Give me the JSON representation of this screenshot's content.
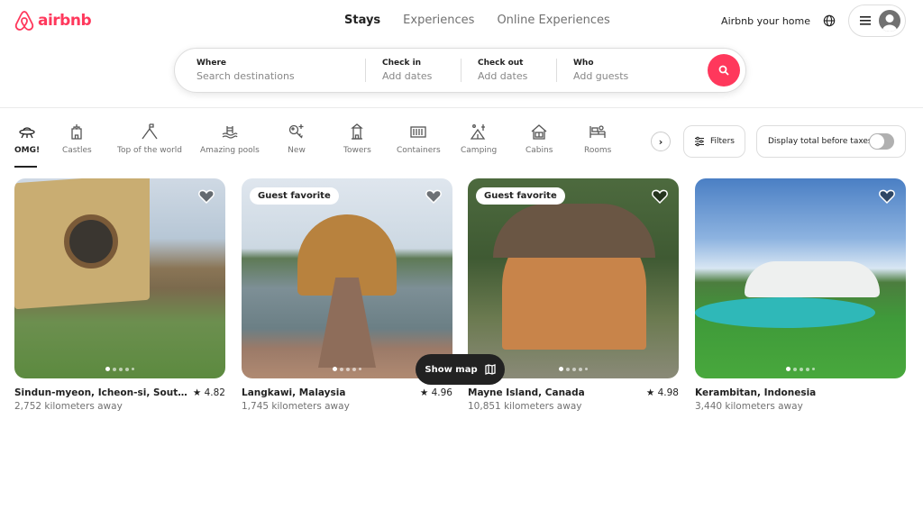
{
  "brand": {
    "name": "airbnb",
    "color": "#ff385c"
  },
  "nav": {
    "tabs": [
      {
        "label": "Stays",
        "active": true
      },
      {
        "label": "Experiences",
        "active": false
      },
      {
        "label": "Online Experiences",
        "active": false
      }
    ]
  },
  "header_right": {
    "host_label": "Airbnb your home",
    "globe_icon": "globe-icon",
    "menu_icon": "hamburger-icon",
    "avatar_icon": "user-avatar-icon"
  },
  "search": {
    "where": {
      "label": "Where",
      "placeholder": "Search destinations"
    },
    "check_in": {
      "label": "Check in",
      "placeholder": "Add dates"
    },
    "check_out": {
      "label": "Check out",
      "placeholder": "Add dates"
    },
    "who": {
      "label": "Who",
      "placeholder": "Add guests"
    },
    "button_icon": "search-icon"
  },
  "categories": [
    {
      "label": "OMG!",
      "icon": "ufo-icon",
      "active": true
    },
    {
      "label": "Castles",
      "icon": "castle-icon"
    },
    {
      "label": "Top of the world",
      "icon": "mountain-flag-icon"
    },
    {
      "label": "Amazing pools",
      "icon": "pool-icon"
    },
    {
      "label": "New",
      "icon": "key-sparkle-icon"
    },
    {
      "label": "Towers",
      "icon": "tower-icon"
    },
    {
      "label": "Containers",
      "icon": "container-icon"
    },
    {
      "label": "Camping",
      "icon": "tent-icon"
    },
    {
      "label": "Cabins",
      "icon": "cabin-icon"
    },
    {
      "label": "Rooms",
      "icon": "bed-icon"
    }
  ],
  "filters": {
    "label": "Filters",
    "icon": "sliders-icon"
  },
  "tax_toggle": {
    "label": "Display total before taxes",
    "on": false
  },
  "listings": [
    {
      "title": "Sindun-myeon, Icheon-si, South Ko...",
      "rating": "4.82",
      "distance": "2,752 kilometers away",
      "badge": ""
    },
    {
      "title": "Langkawi, Malaysia",
      "rating": "4.96",
      "distance": "1,745 kilometers away",
      "badge": "Guest favorite"
    },
    {
      "title": "Mayne Island, Canada",
      "rating": "4.98",
      "distance": "10,851 kilometers away",
      "badge": "Guest favorite"
    },
    {
      "title": "Kerambitan, Indonesia",
      "rating": "",
      "distance": "3,440 kilometers away",
      "badge": ""
    }
  ],
  "map_button": {
    "label": "Show map",
    "icon": "map-icon"
  }
}
